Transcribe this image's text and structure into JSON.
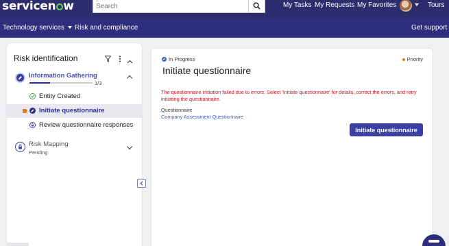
{
  "header": {
    "logo_text_a": "servicen",
    "logo_text_b": "w",
    "search_placeholder": "Search",
    "links": [
      "My Tasks",
      "My Requests",
      "My Favorites"
    ],
    "tours": "Tours"
  },
  "nav": {
    "technology": "Technology services",
    "risk": "Risk and compliance",
    "support": "Get support"
  },
  "sidebar": {
    "title": "Risk identification",
    "stage1": {
      "title": "Information Gathering",
      "progress_text": "1/3",
      "progress_fraction": 0.33,
      "items": [
        {
          "label": "Entity Created",
          "state": "done"
        },
        {
          "label": "Initiate questionnaire",
          "state": "current"
        },
        {
          "label": "Review questionnaire responses",
          "state": "locked"
        }
      ]
    },
    "stage2": {
      "title": "Risk Mapping",
      "status": "Pending"
    }
  },
  "main": {
    "status": "In Progress",
    "priority": "Priority",
    "title": "Initiate questionnaire",
    "error": "The questionnaire initiation failed due to errors. Select 'Initiate questionnaire' for details, correct the errors, and retry initiating the questionnaire.",
    "field_label": "Questionnaire",
    "field_value": "Company Assessment Questionnaire",
    "button": "Initiate questionnaire"
  },
  "colors": {
    "header_bg": "#2d2d6e",
    "nav_bg": "#2e2e7e",
    "accent": "#3a3fa0",
    "error": "#d4111e",
    "link": "#3a5fc0",
    "logo_green": "#62d84e"
  }
}
